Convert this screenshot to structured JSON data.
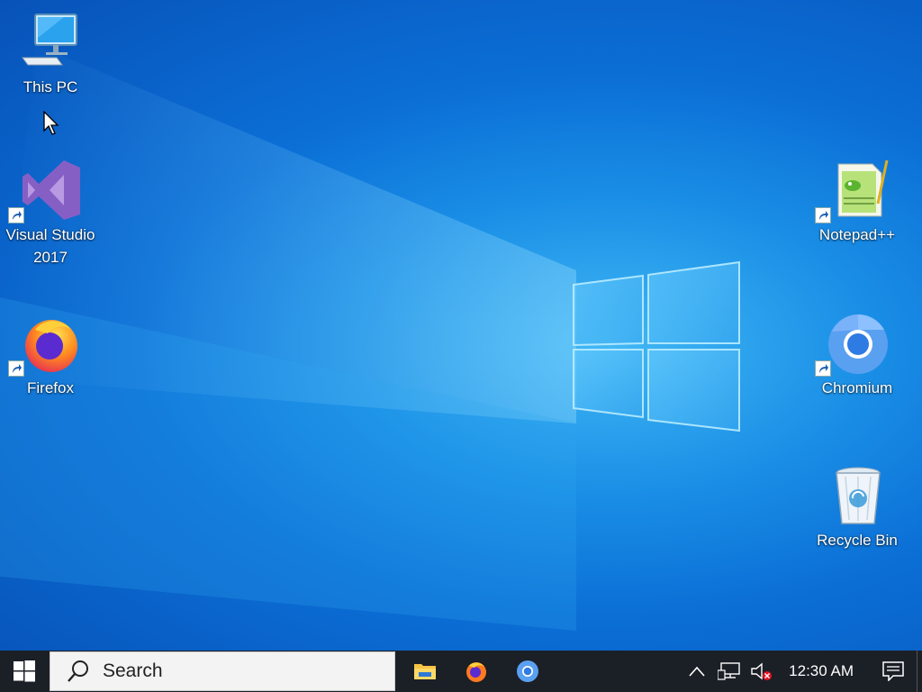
{
  "desktop": {
    "icons": {
      "this_pc": {
        "label": "This PC",
        "icon": "computer-icon"
      },
      "visual_studio": {
        "label_line1": "Visual Studio",
        "label_line2": "2017",
        "icon": "visual-studio-icon"
      },
      "firefox": {
        "label": "Firefox",
        "icon": "firefox-icon"
      },
      "notepadpp": {
        "label": "Notepad++",
        "icon": "notepadpp-icon"
      },
      "chromium": {
        "label": "Chromium",
        "icon": "chromium-icon"
      },
      "recycle_bin": {
        "label": "Recycle Bin",
        "icon": "recycle-bin-icon"
      }
    }
  },
  "taskbar": {
    "search_placeholder": "Search",
    "pinned": [
      "file-explorer-icon",
      "firefox-icon",
      "chromium-icon"
    ],
    "clock": "12:30 AM"
  },
  "colors": {
    "taskbar": "#1b1f26",
    "wallpaper_center": "#42b8f5",
    "wallpaper_edge": "#0752b8"
  }
}
